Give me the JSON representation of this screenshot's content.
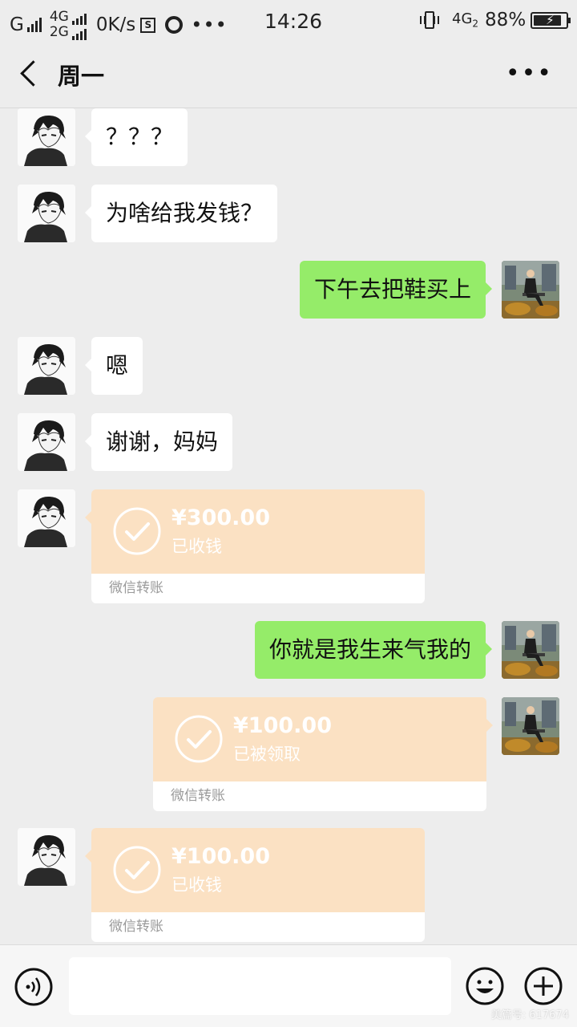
{
  "status_bar": {
    "sim1": "G",
    "net_top": "4G",
    "net_bottom": "2G",
    "speed": "0K/s",
    "s_icon": "S",
    "more": "•••",
    "time": "14:26",
    "net2": "4G",
    "net2_sub": "2",
    "battery": "88%"
  },
  "header": {
    "title": "周一",
    "more": "•••"
  },
  "messages": [
    {
      "side": "left",
      "type": "text",
      "text": "？？？"
    },
    {
      "side": "left",
      "type": "text",
      "text": "为啥给我发钱？"
    },
    {
      "side": "right",
      "type": "text",
      "text": "下午去把鞋买上"
    },
    {
      "side": "left",
      "type": "text",
      "text": "嗯"
    },
    {
      "side": "left",
      "type": "text",
      "text": "谢谢，妈妈"
    },
    {
      "side": "left",
      "type": "transfer",
      "amount": "¥300.00",
      "status": "已收钱",
      "footer": "微信转账"
    },
    {
      "side": "right",
      "type": "text",
      "text": "你就是我生来气我的"
    },
    {
      "side": "right",
      "type": "transfer",
      "amount": "¥100.00",
      "status": "已被领取",
      "footer": "微信转账"
    },
    {
      "side": "left",
      "type": "transfer",
      "amount": "¥100.00",
      "status": "已收钱",
      "footer": "微信转账"
    }
  ],
  "input_bar": {
    "voice_icon": "voice-icon",
    "emoji_icon": "emoji-icon",
    "plus_icon": "plus-icon"
  },
  "watermark": "美篇号: 617674",
  "colors": {
    "bg": "#ededed",
    "green_bubble": "#95ec69",
    "transfer": "#fbe1c3"
  }
}
